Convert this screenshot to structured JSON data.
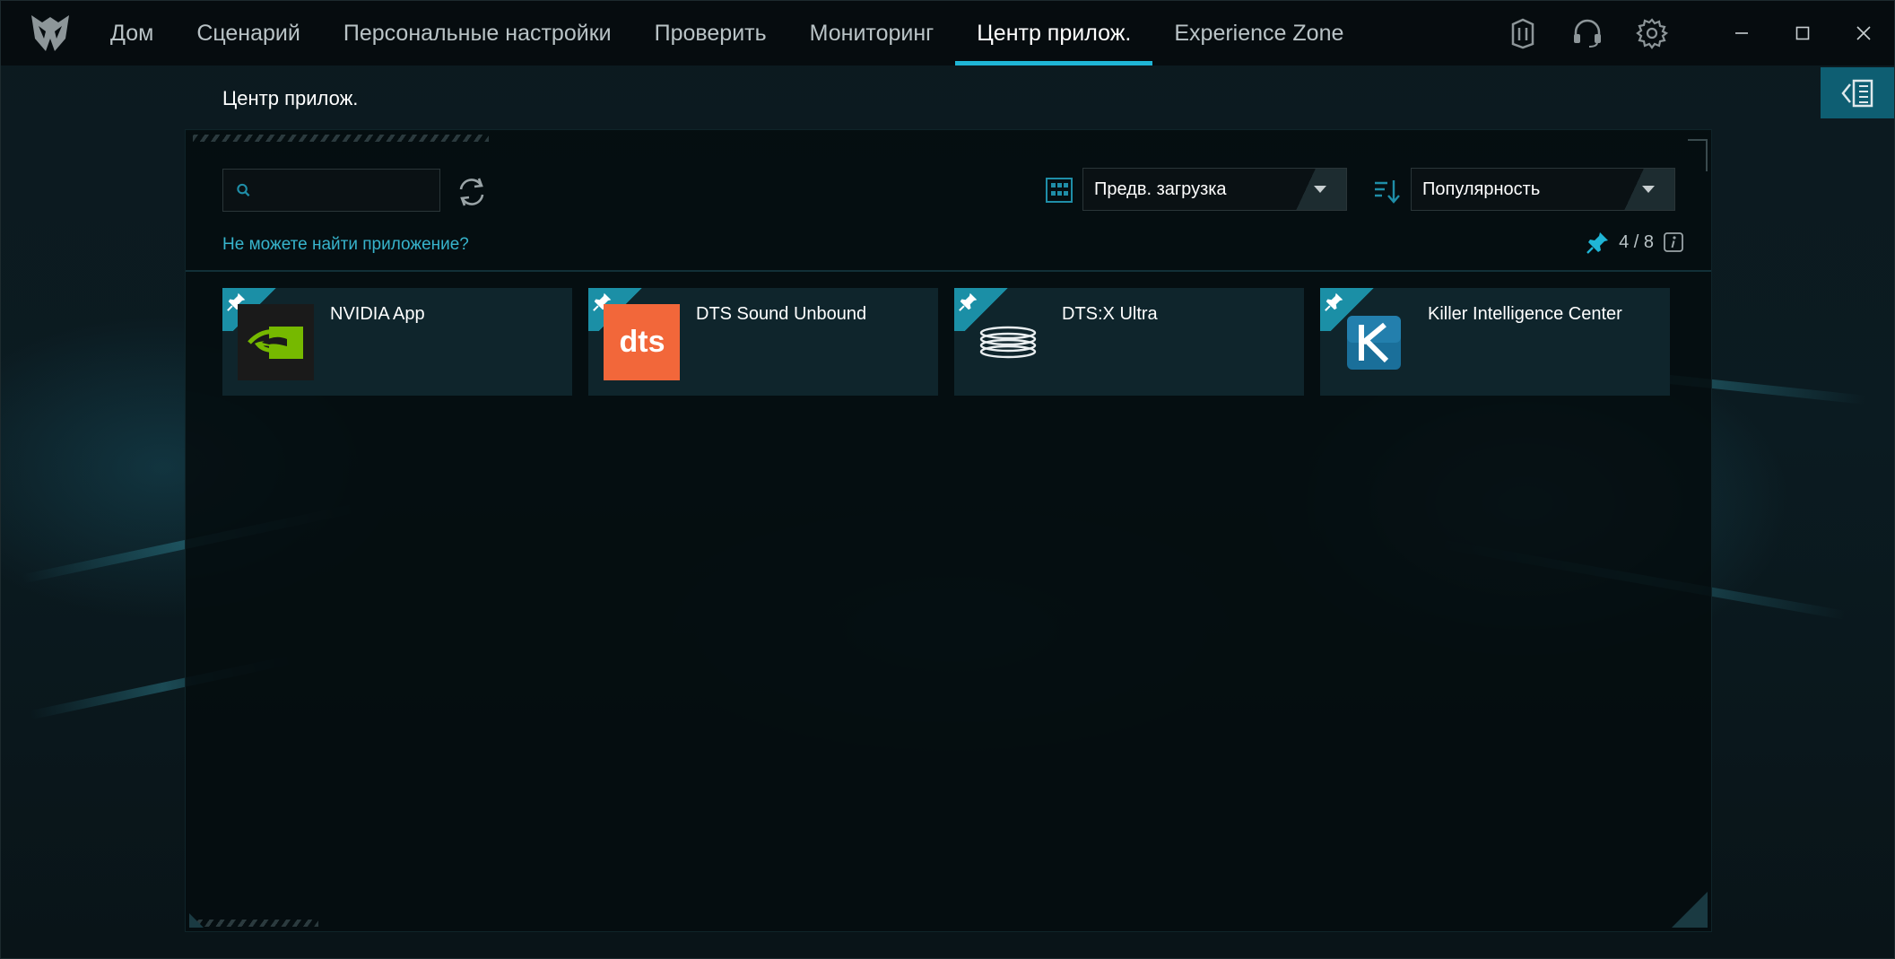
{
  "nav": {
    "items": [
      {
        "label": "Дом",
        "active": false
      },
      {
        "label": "Сценарий",
        "active": false
      },
      {
        "label": "Персональные настройки",
        "active": false
      },
      {
        "label": "Проверить",
        "active": false
      },
      {
        "label": "Мониторинг",
        "active": false
      },
      {
        "label": "Центр прилож.",
        "active": true
      },
      {
        "label": "Experience Zone",
        "active": false
      }
    ]
  },
  "page": {
    "title": "Центр прилож."
  },
  "search": {
    "placeholder": "",
    "value": ""
  },
  "filter": {
    "selected": "Предв. загрузка"
  },
  "sort": {
    "selected": "Популярность"
  },
  "cant_find_link": "Не можете найти приложение?",
  "pinned": {
    "text": "4 / 8"
  },
  "apps": [
    {
      "name": "NVIDIA App",
      "icon": "nvidia-icon",
      "pinned": true
    },
    {
      "name": "DTS Sound Unbound",
      "icon": "dts-icon",
      "pinned": true
    },
    {
      "name": "DTS:X Ultra",
      "icon": "dtsx-ultra-icon",
      "pinned": true
    },
    {
      "name": "Killer Intelligence Center",
      "icon": "killer-icon",
      "pinned": true
    }
  ],
  "colors": {
    "accent": "#1fb5d6",
    "link": "#37b4cc",
    "card_bg": "#0f252c",
    "dts_orange": "#f2673a",
    "nvidia_green": "#76b900"
  }
}
